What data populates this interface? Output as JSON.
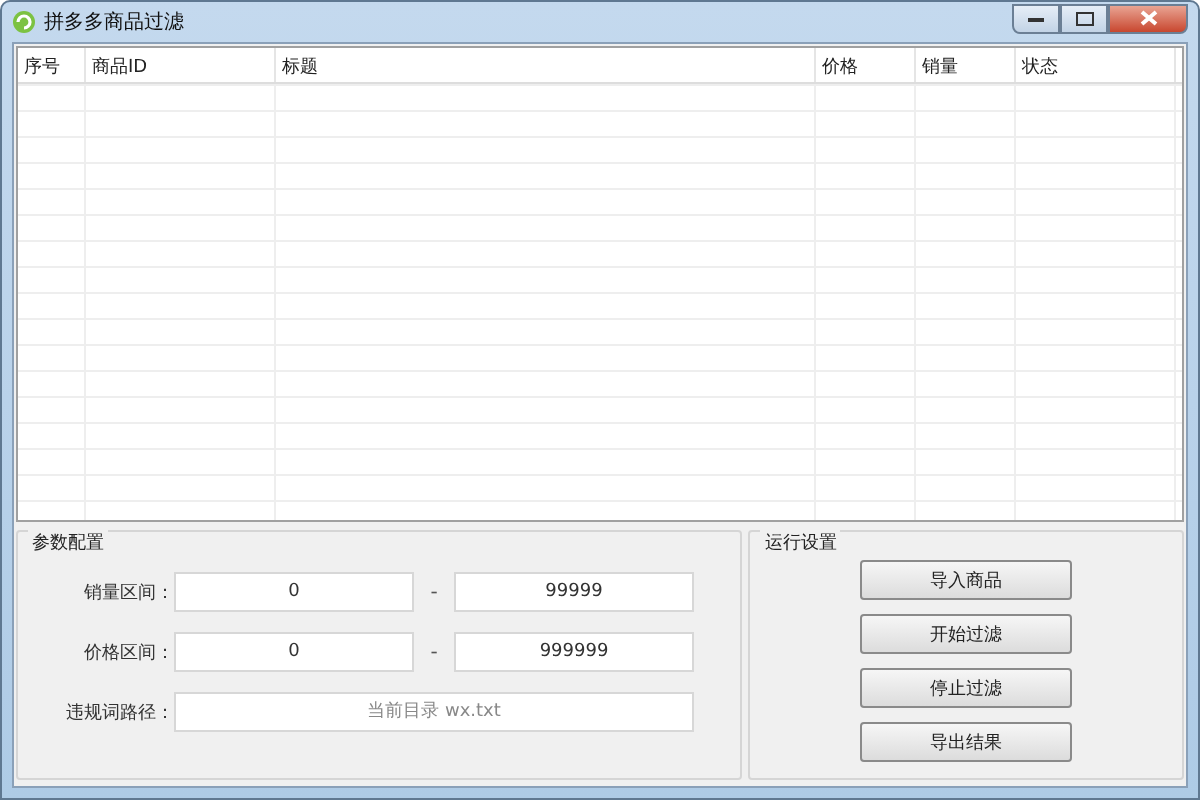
{
  "window": {
    "title": "拼多多商品过滤"
  },
  "table": {
    "columns": [
      "序号",
      "商品ID",
      "标题",
      "价格",
      "销量",
      "状态"
    ]
  },
  "params": {
    "title": "参数配置",
    "sales_range": {
      "label": "销量区间：",
      "from": "0",
      "to": "99999",
      "dash": "-"
    },
    "price_range": {
      "label": "价格区间：",
      "from": "0",
      "to": "999999",
      "dash": "-"
    },
    "path": {
      "label": "违规词路径：",
      "placeholder": "当前目录 wx.txt"
    }
  },
  "run": {
    "title": "运行设置",
    "buttons": [
      "导入商品",
      "开始过滤",
      "停止过滤",
      "导出结果"
    ]
  }
}
